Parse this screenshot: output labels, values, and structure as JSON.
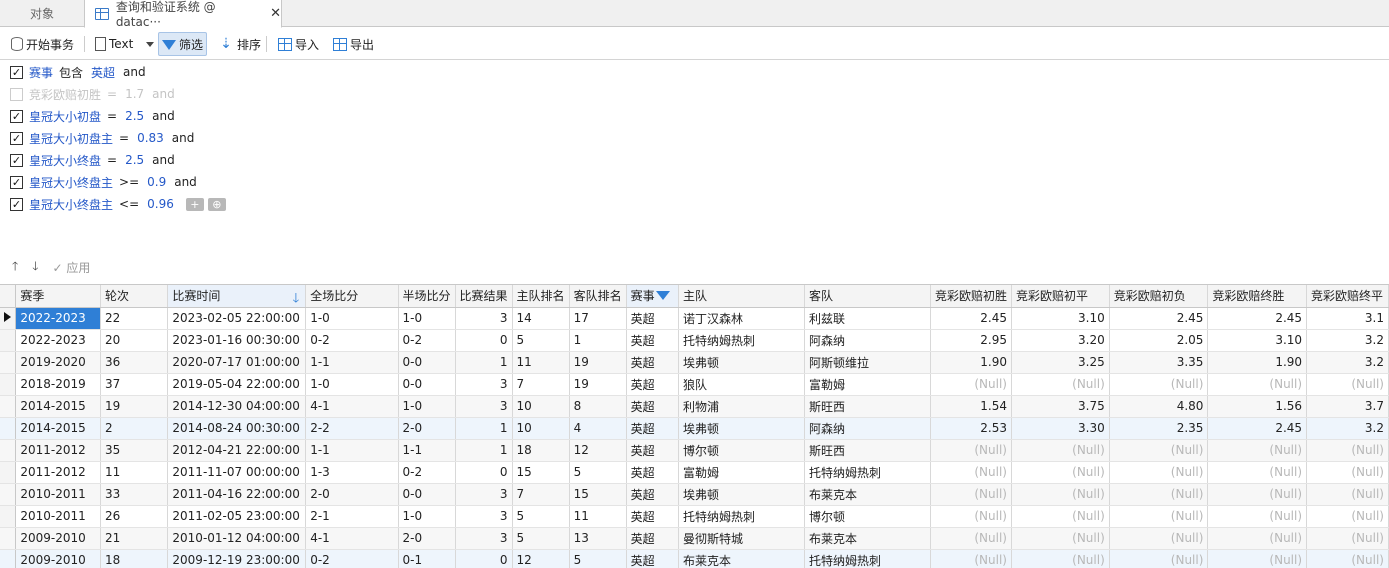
{
  "tabs": [
    {
      "label": "对象"
    },
    {
      "label": "查询和验证系统 @ datac···"
    }
  ],
  "toolbar": {
    "begin_transaction": "开始事务",
    "text": "Text",
    "filter": "筛选",
    "sort": "排序",
    "import": "导入",
    "export": "导出"
  },
  "filter": {
    "conditions": [
      {
        "enabled": true,
        "field": "赛事",
        "op": "包含",
        "value": "英超",
        "conj": "and"
      },
      {
        "enabled": false,
        "field": "竞彩欧赔初胜",
        "op": "=",
        "value": "1.7",
        "conj": "and"
      },
      {
        "enabled": true,
        "field": "皇冠大小初盘",
        "op": "=",
        "value": "2.5",
        "conj": "and"
      },
      {
        "enabled": true,
        "field": "皇冠大小初盘主",
        "op": "=",
        "value": "0.83",
        "conj": "and"
      },
      {
        "enabled": true,
        "field": "皇冠大小终盘",
        "op": "=",
        "value": "2.5",
        "conj": "and"
      },
      {
        "enabled": true,
        "field": "皇冠大小终盘主",
        "op": ">=",
        "value": "0.9",
        "conj": "and"
      },
      {
        "enabled": true,
        "field": "皇冠大小终盘主",
        "op": "<=",
        "value": "0.96",
        "conj": ""
      }
    ],
    "add_label": "+",
    "apply_label": "应用"
  },
  "grid": {
    "columns": [
      "赛季",
      "轮次",
      "比赛时间",
      "全场比分",
      "半场比分",
      "比赛结果",
      "主队排名",
      "客队排名",
      "赛事",
      "主队",
      "客队",
      "竞彩欧赔初胜",
      "竞彩欧赔初平",
      "竞彩欧赔初负",
      "竞彩欧赔终胜",
      "竞彩欧赔终平"
    ],
    "rows": [
      [
        "2022-2023",
        "22",
        "2023-02-05 22:00:00",
        "1-0",
        "1-0",
        "3",
        "14",
        "17",
        "英超",
        "诺丁汉森林",
        "利兹联",
        "2.45",
        "3.10",
        "2.45",
        "2.45",
        "3.1"
      ],
      [
        "2022-2023",
        "20",
        "2023-01-16 00:30:00",
        "0-2",
        "0-2",
        "0",
        "5",
        "1",
        "英超",
        "托特纳姆热刺",
        "阿森纳",
        "2.95",
        "3.20",
        "2.05",
        "3.10",
        "3.2"
      ],
      [
        "2019-2020",
        "36",
        "2020-07-17 01:00:00",
        "1-1",
        "0-0",
        "1",
        "11",
        "19",
        "英超",
        "埃弗顿",
        "阿斯顿维拉",
        "1.90",
        "3.25",
        "3.35",
        "1.90",
        "3.2"
      ],
      [
        "2018-2019",
        "37",
        "2019-05-04 22:00:00",
        "1-0",
        "0-0",
        "3",
        "7",
        "19",
        "英超",
        "狼队",
        "富勒姆",
        "(Null)",
        "(Null)",
        "(Null)",
        "(Null)",
        "(Null)"
      ],
      [
        "2014-2015",
        "19",
        "2014-12-30 04:00:00",
        "4-1",
        "1-0",
        "3",
        "10",
        "8",
        "英超",
        "利物浦",
        "斯旺西",
        "1.54",
        "3.75",
        "4.80",
        "1.56",
        "3.7"
      ],
      [
        "2014-2015",
        "2",
        "2014-08-24 00:30:00",
        "2-2",
        "2-0",
        "1",
        "10",
        "4",
        "英超",
        "埃弗顿",
        "阿森纳",
        "2.53",
        "3.30",
        "2.35",
        "2.45",
        "3.2"
      ],
      [
        "2011-2012",
        "35",
        "2012-04-21 22:00:00",
        "1-1",
        "1-1",
        "1",
        "18",
        "12",
        "英超",
        "博尔顿",
        "斯旺西",
        "(Null)",
        "(Null)",
        "(Null)",
        "(Null)",
        "(Null)"
      ],
      [
        "2011-2012",
        "11",
        "2011-11-07 00:00:00",
        "1-3",
        "0-2",
        "0",
        "15",
        "5",
        "英超",
        "富勒姆",
        "托特纳姆热刺",
        "(Null)",
        "(Null)",
        "(Null)",
        "(Null)",
        "(Null)"
      ],
      [
        "2010-2011",
        "33",
        "2011-04-16 22:00:00",
        "2-0",
        "0-0",
        "3",
        "7",
        "15",
        "英超",
        "埃弗顿",
        "布莱克本",
        "(Null)",
        "(Null)",
        "(Null)",
        "(Null)",
        "(Null)"
      ],
      [
        "2010-2011",
        "26",
        "2011-02-05 23:00:00",
        "2-1",
        "1-0",
        "3",
        "5",
        "11",
        "英超",
        "托特纳姆热刺",
        "博尔顿",
        "(Null)",
        "(Null)",
        "(Null)",
        "(Null)",
        "(Null)"
      ],
      [
        "2009-2010",
        "21",
        "2010-01-12 04:00:00",
        "4-1",
        "2-0",
        "3",
        "5",
        "13",
        "英超",
        "曼彻斯特城",
        "布莱克本",
        "(Null)",
        "(Null)",
        "(Null)",
        "(Null)",
        "(Null)"
      ],
      [
        "2009-2010",
        "18",
        "2009-12-19 23:00:00",
        "0-2",
        "0-1",
        "0",
        "12",
        "5",
        "英超",
        "布莱克本",
        "托特纳姆热刺",
        "(Null)",
        "(Null)",
        "(Null)",
        "(Null)",
        "(Null)"
      ]
    ]
  }
}
